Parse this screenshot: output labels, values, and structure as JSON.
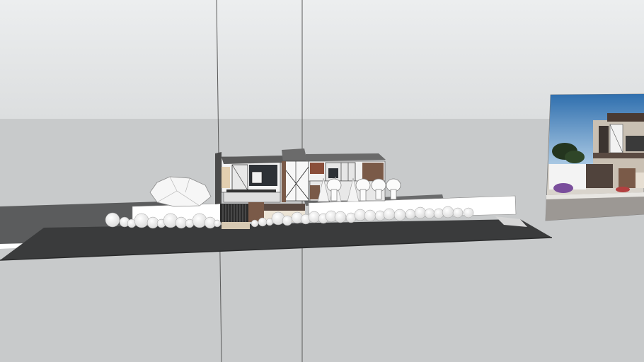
{
  "viewport": {
    "kind": "3d-model-scene",
    "colors": {
      "sky_top": "#e6e8e9",
      "sky_bottom": "#d8dadb",
      "ground": "#c8cacb",
      "road": "#3a3b3c",
      "wall": "#ffffff",
      "axis": "#4a4a4a",
      "wood": "#7a5a48",
      "glass": "#2d3136"
    },
    "reference_photo": {
      "visible": true,
      "sky": "#3d7bb8",
      "facade": "#d9d4cc"
    }
  }
}
